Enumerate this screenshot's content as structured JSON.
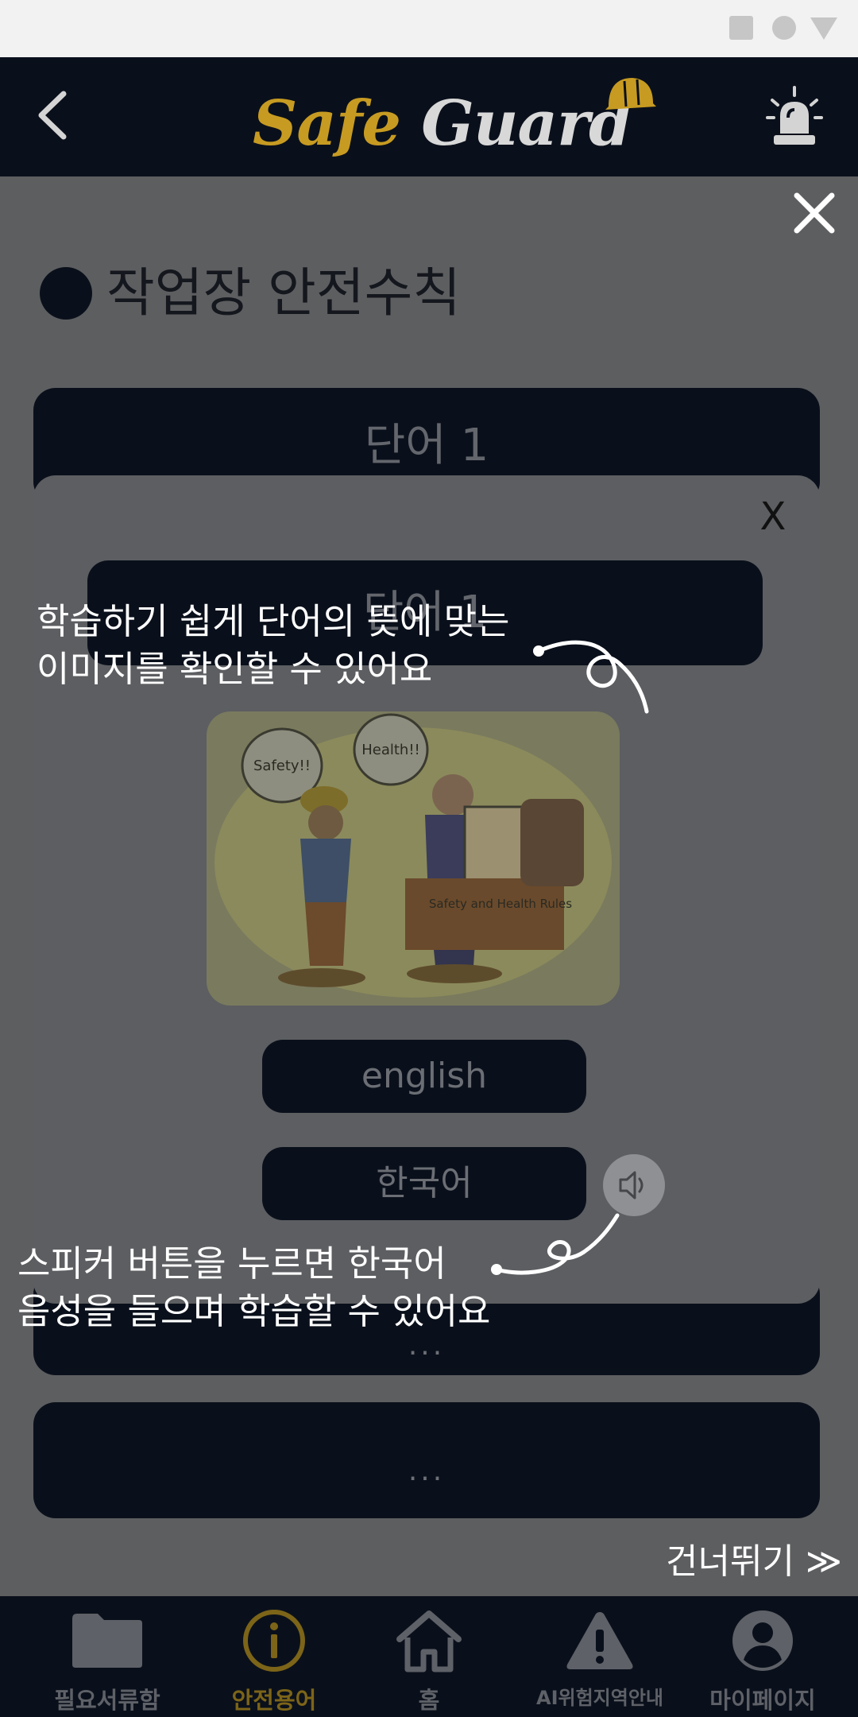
{
  "header": {
    "logo_part1": "Safe",
    "logo_part2": "Guard",
    "back_icon": "chevron-left-icon",
    "alarm_icon": "siren-icon"
  },
  "page": {
    "title": "작업장 안전수칙",
    "cards": [
      {
        "label": "단어 1"
      },
      {
        "label": "..."
      },
      {
        "label": "..."
      }
    ]
  },
  "modal": {
    "close_label": "X",
    "word_label": "단어 1",
    "illustration_texts": [
      "Safety!!",
      "Health!!",
      "Safety and Health Rules"
    ],
    "english_label": "english",
    "korean_label": "한국어",
    "speaker_icon": "speaker-icon"
  },
  "overlay": {
    "hint_top_line1": "학습하기 쉽게 단어의 뜻에 맞는",
    "hint_top_line2": "이미지를 확인할 수 있어요",
    "hint_bottom_line1": "스피커 버튼을 누르면 한국어",
    "hint_bottom_line2": "음성을 들으며 학습할 수 있어요",
    "skip_label": "건너뛰기 ≫",
    "close_icon": "close-icon"
  },
  "nav": {
    "items": [
      {
        "label": "필요서류함",
        "icon": "folder-icon",
        "active": false
      },
      {
        "label": "안전용어",
        "icon": "info-icon",
        "active": true
      },
      {
        "label": "홈",
        "icon": "home-icon",
        "active": false
      },
      {
        "label": "AI위험지역안내",
        "icon": "warning-icon",
        "active": false
      },
      {
        "label": "마이페이지",
        "icon": "user-icon",
        "active": false
      }
    ]
  },
  "colors": {
    "header_bg": "#0a101b",
    "accent_gold": "#c79b22",
    "dim_bg": "#5d5e60"
  }
}
